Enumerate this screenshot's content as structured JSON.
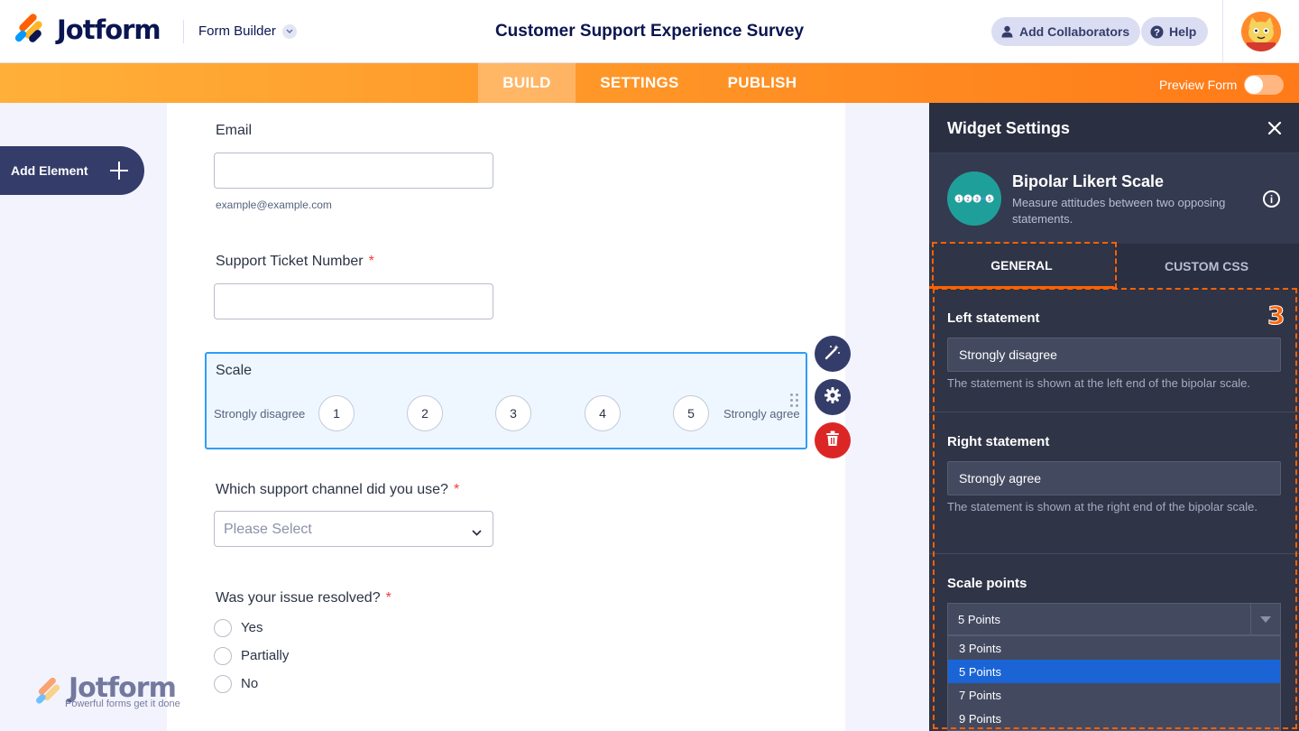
{
  "header": {
    "logo_text": "Jotform",
    "builder_label": "Form Builder",
    "form_title": "Customer Support Experience Survey",
    "add_collaborators": "Add Collaborators",
    "help": "Help"
  },
  "nav": {
    "tabs": [
      {
        "label": "BUILD",
        "active": true
      },
      {
        "label": "SETTINGS",
        "active": false
      },
      {
        "label": "PUBLISH",
        "active": false
      }
    ],
    "preview_label": "Preview Form",
    "preview_on": false
  },
  "sidebar": {
    "add_element": "Add Element"
  },
  "form": {
    "email": {
      "label": "Email",
      "value": "",
      "sublabel": "example@example.com"
    },
    "ticket": {
      "label": "Support Ticket Number",
      "required": "*",
      "value": ""
    },
    "scale": {
      "label": "Scale",
      "left": "Strongly disagree",
      "right": "Strongly agree",
      "points": [
        "1",
        "2",
        "3",
        "4",
        "5"
      ]
    },
    "channel": {
      "label": "Which support channel did you use?",
      "required": "*",
      "placeholder": "Please Select"
    },
    "resolved": {
      "label": "Was your issue resolved?",
      "required": "*",
      "options": [
        "Yes",
        "Partially",
        "No"
      ]
    }
  },
  "watermark": {
    "text": "Jotform",
    "tagline": "Powerful forms get it done"
  },
  "panel": {
    "title": "Widget Settings",
    "widget_name": "Bipolar Likert Scale",
    "widget_desc": "Measure attitudes between two opposing statements.",
    "tabs": [
      {
        "label": "GENERAL",
        "active": true
      },
      {
        "label": "CUSTOM CSS",
        "active": false
      }
    ],
    "step_badge": "3",
    "left_statement": {
      "label": "Left statement",
      "value": "Strongly disagree",
      "help": "The statement is shown at the left end of the bipolar scale."
    },
    "right_statement": {
      "label": "Right statement",
      "value": "Strongly agree",
      "help": "The statement is shown at the right end of the bipolar scale."
    },
    "scale_points": {
      "label": "Scale points",
      "value": "5 Points",
      "options": [
        "3 Points",
        "5 Points",
        "7 Points",
        "9 Points"
      ],
      "selected": "5 Points"
    }
  },
  "colors": {
    "orange": "#ff6100",
    "navy": "#0a1551",
    "selection_blue": "#2e9df7",
    "delete_red": "#dc2626",
    "panel_bg": "#2f3446"
  },
  "icons": [
    "logo-icon",
    "chevron-down-icon",
    "user-icon",
    "help-icon",
    "plus-icon",
    "magic-wand-icon",
    "gear-icon",
    "trash-icon",
    "drag-handle-icon",
    "close-icon",
    "info-icon",
    "likert-scale-icon"
  ]
}
